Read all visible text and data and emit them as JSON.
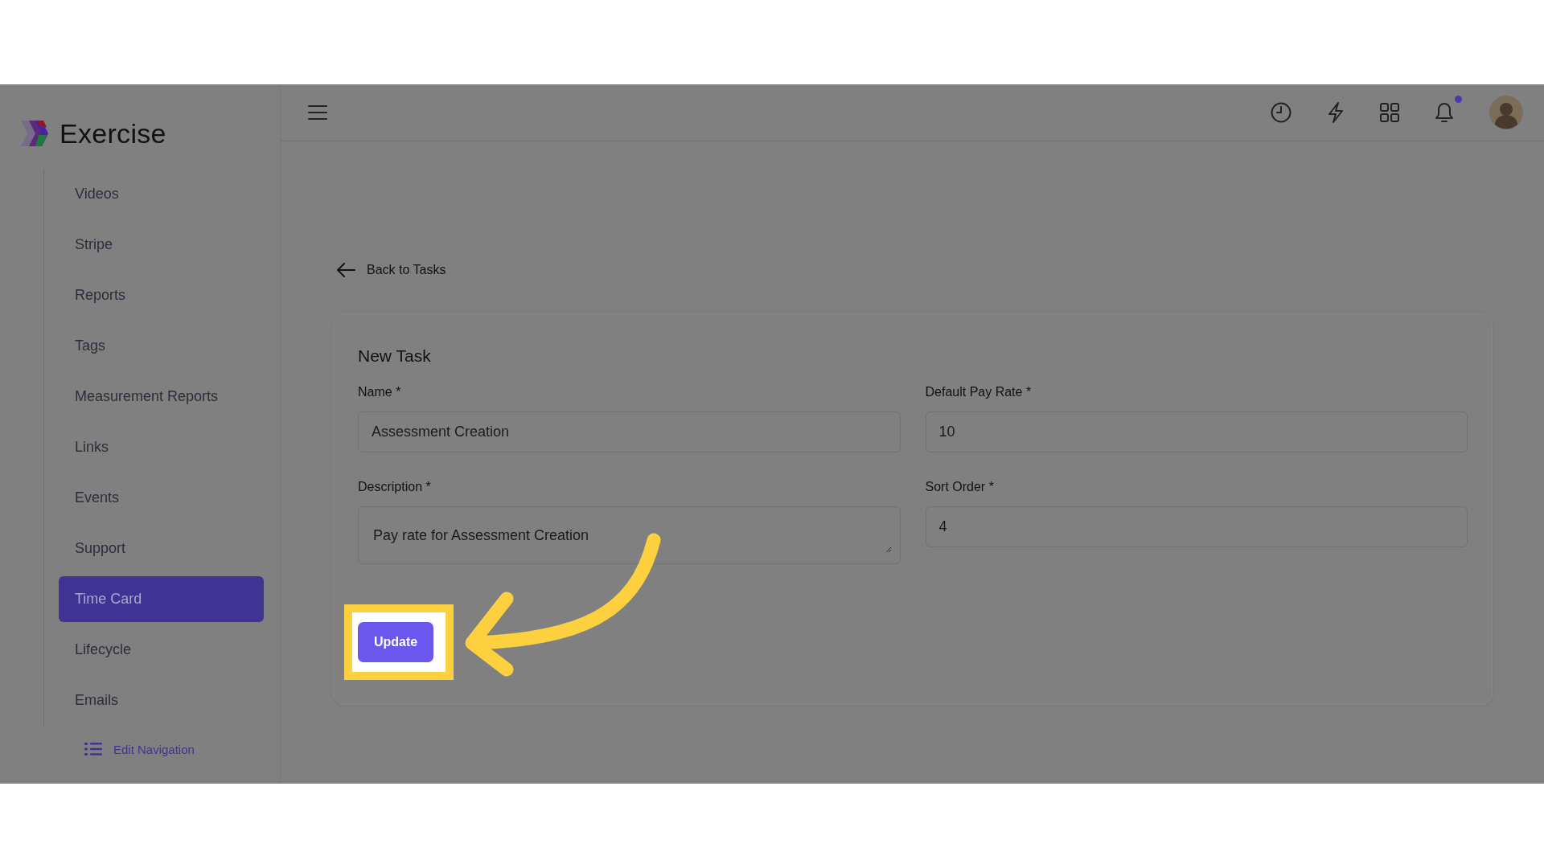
{
  "brand": {
    "name": "Exercise"
  },
  "sidebar": {
    "items": [
      {
        "label": "Videos",
        "selected": false
      },
      {
        "label": "Stripe",
        "selected": false
      },
      {
        "label": "Reports",
        "selected": false
      },
      {
        "label": "Tags",
        "selected": false
      },
      {
        "label": "Measurement Reports",
        "selected": false
      },
      {
        "label": "Links",
        "selected": false
      },
      {
        "label": "Events",
        "selected": false
      },
      {
        "label": "Support",
        "selected": false
      },
      {
        "label": "Time Card",
        "selected": true
      },
      {
        "label": "Lifecycle",
        "selected": false
      },
      {
        "label": "Emails",
        "selected": false
      }
    ],
    "edit_navigation": "Edit Navigation"
  },
  "header": {
    "notification_dot": true
  },
  "back_link": "Back to Tasks",
  "form": {
    "title": "New Task",
    "fields": [
      {
        "label": "Name *",
        "value": "Assessment Creation",
        "kind": "text"
      },
      {
        "label": "Default Pay Rate *",
        "value": "10",
        "kind": "text"
      },
      {
        "label": "Description *",
        "value": "Pay rate for Assessment Creation",
        "kind": "textarea"
      },
      {
        "label": "Sort Order *",
        "value": "4",
        "kind": "text"
      }
    ],
    "buttons": [
      {
        "label": "Update",
        "kind": "primary",
        "highlighted": true
      }
    ]
  }
}
